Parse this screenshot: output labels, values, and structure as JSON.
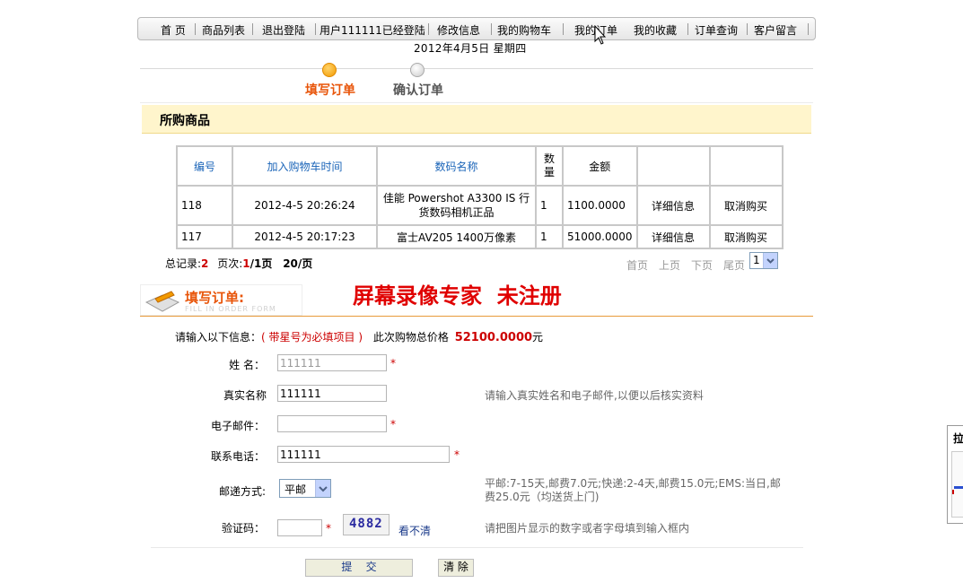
{
  "nav": {
    "items": [
      "首 页",
      "商品列表",
      "退出登陆",
      "用户111111已经登陆",
      "修改信息",
      "我的购物车",
      "我的订单",
      "我的收藏",
      "订单查询",
      "客户留言"
    ]
  },
  "date": "2012年4月5日  星期四",
  "steps": {
    "step1": "填写订单",
    "step2": "确认订单"
  },
  "purchased_title": "所购商品",
  "table": {
    "headers": [
      "编号",
      "加入购物车时间",
      "数码名称",
      "数量",
      "金额",
      "",
      ""
    ],
    "rows": [
      {
        "id": "118",
        "time": "2012-4-5 20:26:24",
        "name": "佳能 Powershot A3300 IS 行货数码相机正品",
        "qty": "1",
        "amount": "1100.0000",
        "detail": "详细信息",
        "cancel": "取消购买"
      },
      {
        "id": "117",
        "time": "2012-4-5 20:17:23",
        "name": "富士AV205 1400万像素",
        "qty": "1",
        "amount": "51000.0000",
        "detail": "详细信息",
        "cancel": "取消购买"
      }
    ]
  },
  "pager": {
    "total_label": "总记录:",
    "total": "2",
    "page_label": "页次:",
    "page_cur": "1",
    "page_sep": "/1页",
    "per_page": "20/页",
    "first": "首页",
    "prev": "上页",
    "next": "下页",
    "last": "尾页",
    "select": "1"
  },
  "order_form": {
    "banner_title": "填写订单:",
    "banner_sub": "FILL IN ORDER FORM",
    "watermark": "屏幕录像专家  未注册",
    "intro": "请输入以下信息：",
    "required_note": "( 带星号为必填项目 )",
    "total_label": "此次购物总价格",
    "total_value": "52100.0000",
    "total_unit": "元",
    "name_label": "姓 名：",
    "name_value": "111111",
    "realname_label": "真实名称",
    "realname_value": "111111",
    "realname_hint": "请输入真实姓名和电子邮件,以便以后核实资料",
    "email_label": "电子邮件：",
    "email_value": "",
    "phone_label": "联系电话：",
    "phone_value": "111111",
    "ship_label": "邮递方式:",
    "ship_value": "平邮",
    "ship_hint_1": "平邮:7-15天,邮费7.0元;快递:2-4天,邮费15.0元;EMS:当日,邮",
    "ship_hint_2": "费25.0元（均送货上门)",
    "captcha_label": "验证码：",
    "captcha_value": "",
    "captcha_image_text": "4882",
    "captcha_refresh": "看不清",
    "captcha_hint": "请把图片显示的数字或者字母填到输入框内",
    "submit": "提    交",
    "clear": "清 除"
  },
  "side_panel": {
    "label": "拉"
  },
  "colors": {
    "accent_orange": "#e8550a",
    "required_red": "#cc0000",
    "link_blue": "#1a64b8",
    "watermark_red": "#e00000"
  }
}
